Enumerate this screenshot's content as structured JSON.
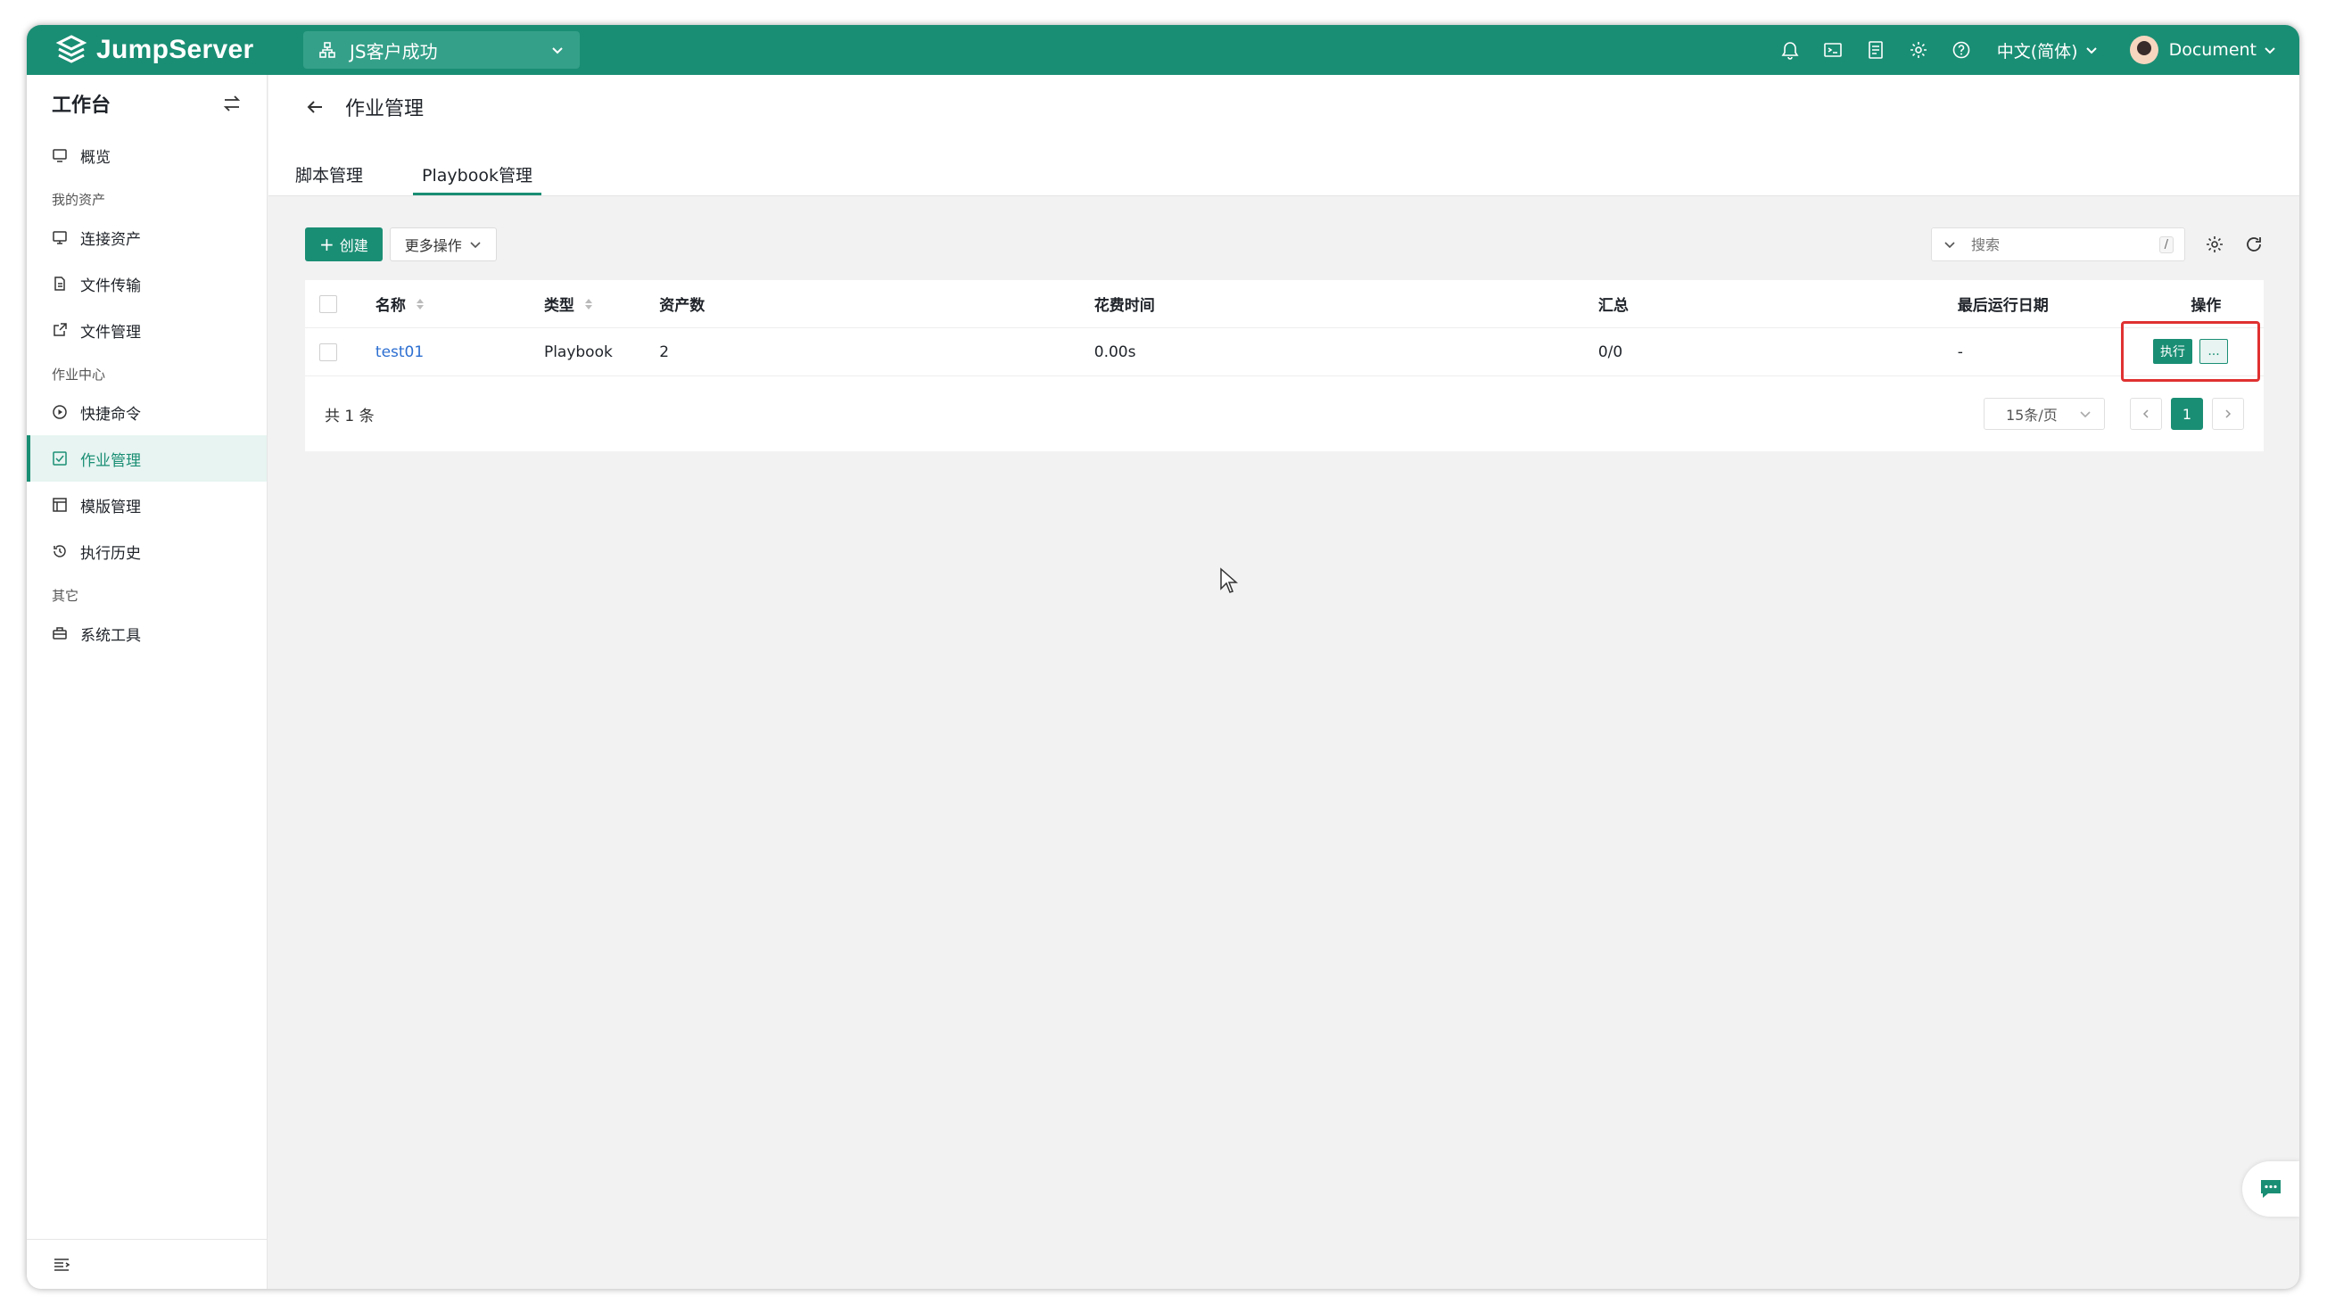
{
  "app": {
    "logo_text": "JumpServer"
  },
  "org_selector": {
    "value": "JS客户成功"
  },
  "topbar": {
    "language": "中文(简体)",
    "user_name": "Document"
  },
  "sidebar": {
    "title": "工作台",
    "overview": "概览",
    "group_assets": "我的资产",
    "connect_assets": "连接资产",
    "file_transfer": "文件传输",
    "file_manage": "文件管理",
    "group_jobs": "作业中心",
    "quick_command": "快捷命令",
    "job_manage": "作业管理",
    "template_manage": "模版管理",
    "exec_history": "执行历史",
    "group_other": "其它",
    "system_tools": "系统工具"
  },
  "page": {
    "title": "作业管理",
    "tabs": [
      {
        "label": "脚本管理",
        "active": false
      },
      {
        "label": "Playbook管理",
        "active": true
      }
    ]
  },
  "toolbar": {
    "create_label": "创建",
    "more_label": "更多操作",
    "search_placeholder": "搜索",
    "search_shortcut": "/"
  },
  "table": {
    "columns": [
      "名称",
      "类型",
      "资产数",
      "花费时间",
      "汇总",
      "最后运行日期",
      "操作"
    ],
    "rows": [
      {
        "name": "test01",
        "type": "Playbook",
        "assets": "2",
        "time": "0.00s",
        "summary": "0/0",
        "last_run": "-"
      }
    ],
    "actions": {
      "exec_label": "执行",
      "more_label": "..."
    }
  },
  "pagination": {
    "total": "共 1 条",
    "page_size": "15条/页",
    "current": "1"
  },
  "colors": {
    "brand": "#1a8e74",
    "highlight_box": "#e03131",
    "link": "#2d6fd1"
  }
}
